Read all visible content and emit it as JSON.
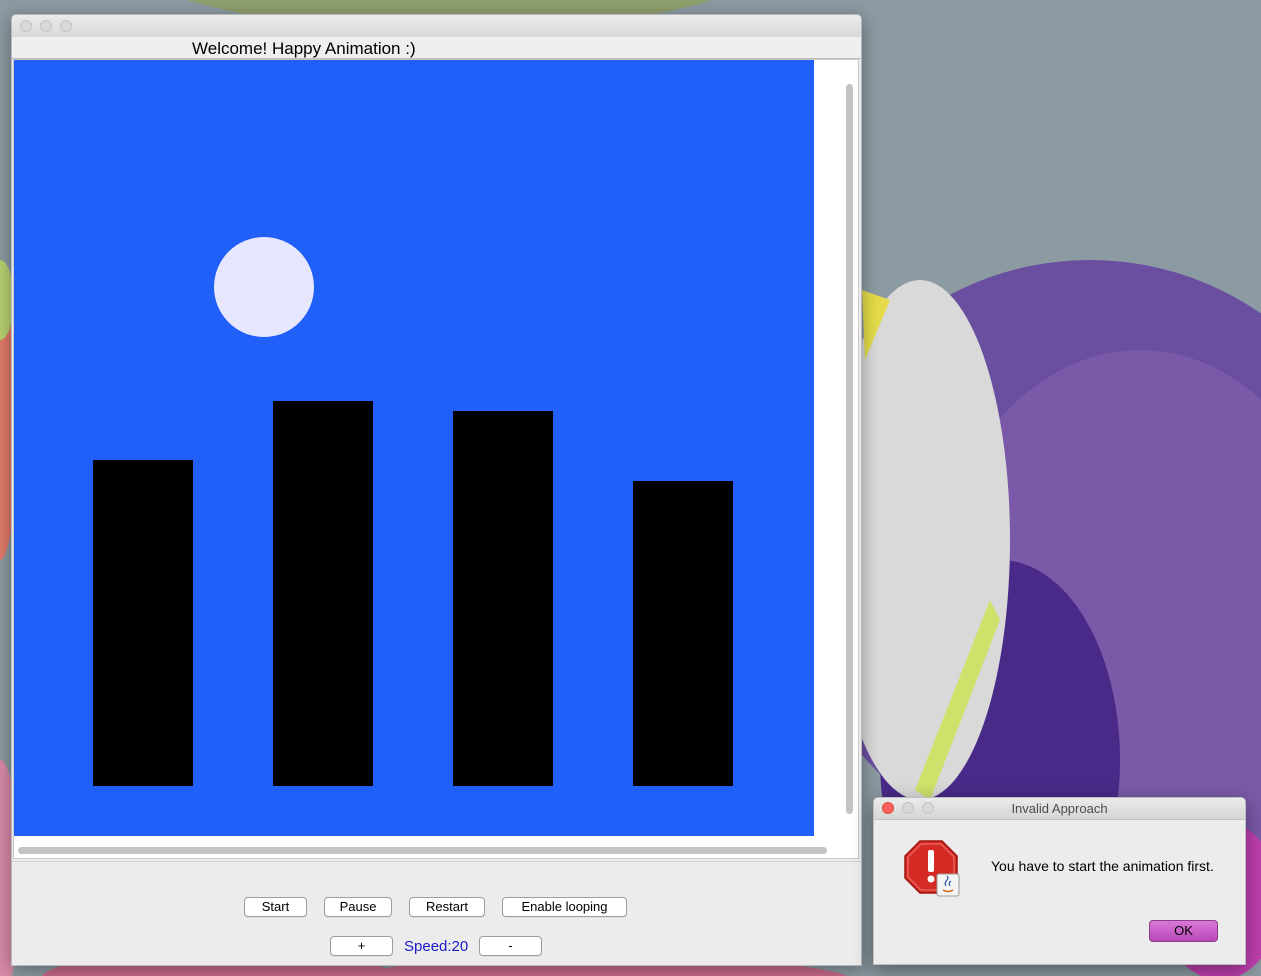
{
  "main_window": {
    "welcome_text": "Welcome! Happy Animation :)",
    "scene": {
      "sky_color": "#2160f8",
      "moon_color": "#e6e6fc",
      "building_color": "#000000"
    },
    "controls": {
      "start_label": "Start",
      "pause_label": "Pause",
      "restart_label": "Restart",
      "loop_label": "Enable looping",
      "plus_label": "+",
      "minus_label": "-",
      "speed_text": "Speed:20"
    }
  },
  "dialog": {
    "title": "Invalid Approach",
    "message": "You have to start the animation first.",
    "ok_label": "OK",
    "icon": "stop-warning-icon"
  }
}
